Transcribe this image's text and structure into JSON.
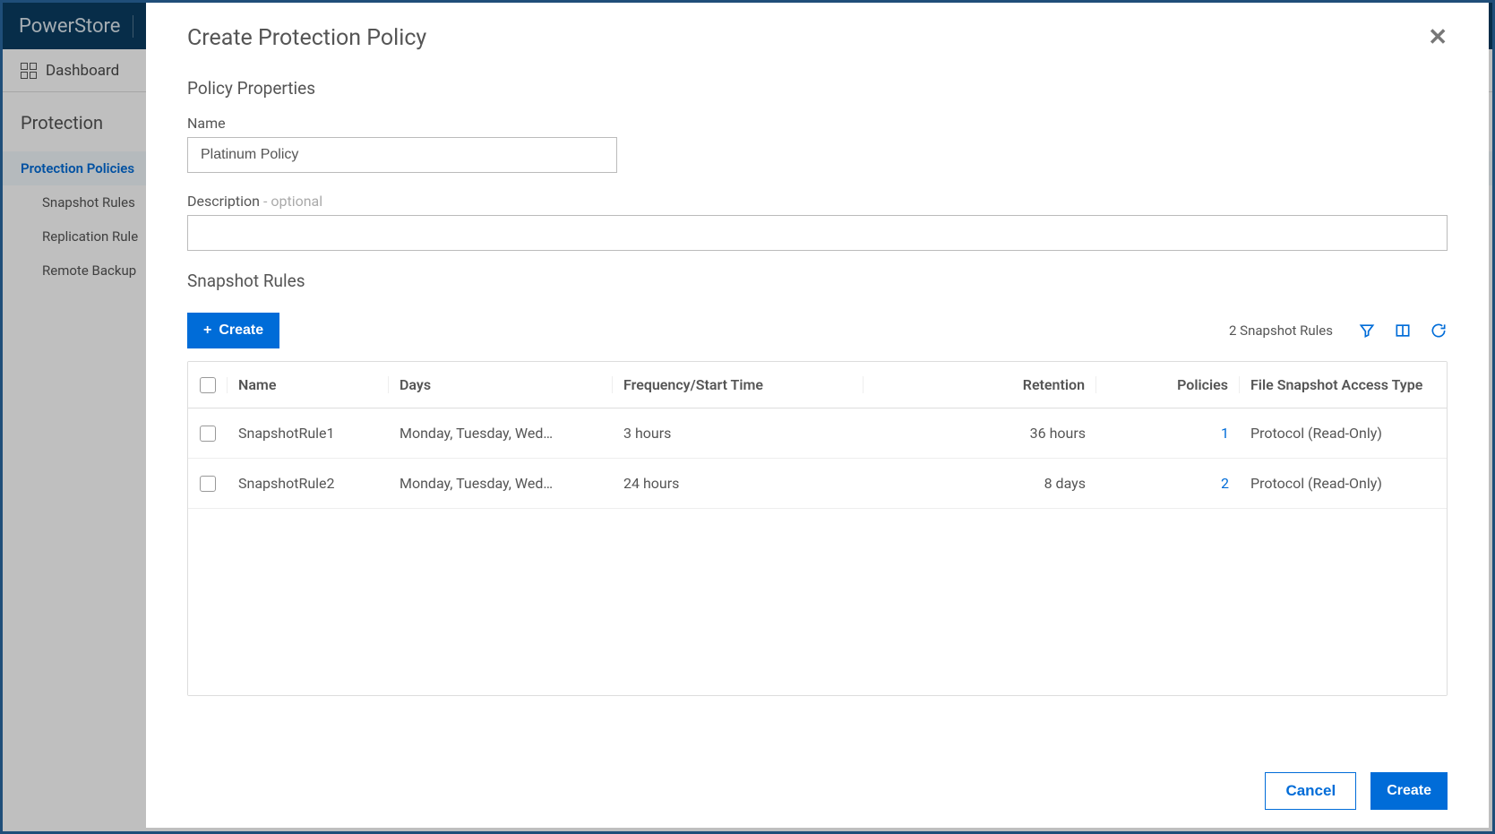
{
  "app": {
    "brand": "PowerStore"
  },
  "nav": {
    "dashboard": "Dashboard",
    "section": "Protection",
    "items": [
      {
        "label": "Protection Policies"
      },
      {
        "label": "Snapshot Rules"
      },
      {
        "label": "Replication Rule"
      },
      {
        "label": "Remote Backup"
      }
    ]
  },
  "modal": {
    "title": "Create Protection Policy",
    "properties_heading": "Policy Properties",
    "name_label": "Name",
    "name_value": "Platinum Policy",
    "desc_label": "Description",
    "desc_optional": " - optional",
    "desc_value": "",
    "snapshot_heading": "Snapshot Rules",
    "create_button": "Create",
    "count_text": "2 Snapshot Rules",
    "columns": {
      "name": "Name",
      "days": "Days",
      "freq": "Frequency/Start Time",
      "retention": "Retention",
      "policies": "Policies",
      "access": "File Snapshot Access Type"
    },
    "rows": [
      {
        "name": "SnapshotRule1",
        "days": "Monday, Tuesday, Wed…",
        "freq": "3 hours",
        "retention": "36 hours",
        "policies": "1",
        "access": "Protocol (Read-Only)"
      },
      {
        "name": "SnapshotRule2",
        "days": "Monday, Tuesday, Wed…",
        "freq": "24 hours",
        "retention": "8 days",
        "policies": "2",
        "access": "Protocol (Read-Only)"
      }
    ],
    "footer": {
      "cancel": "Cancel",
      "create": "Create"
    }
  }
}
